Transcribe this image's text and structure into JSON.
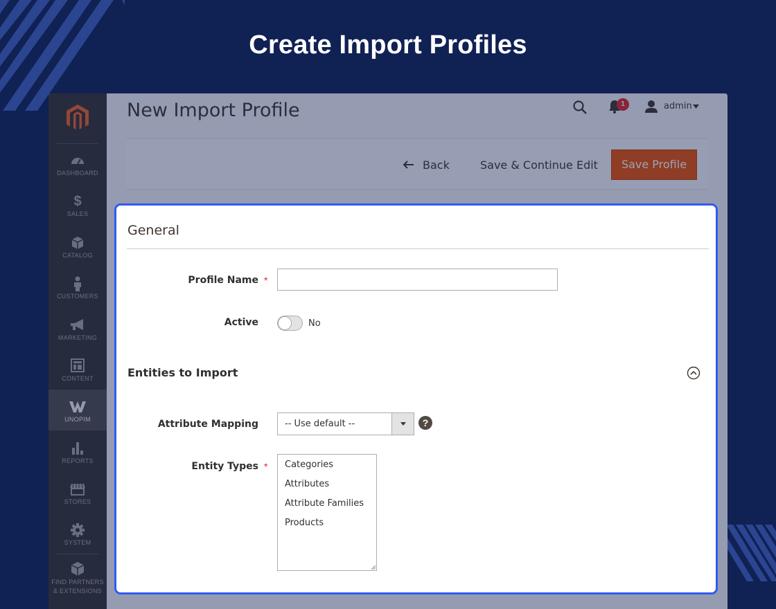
{
  "hero": {
    "title": "Create Import Profiles"
  },
  "sidebar": {
    "items": [
      {
        "label": "DASHBOARD",
        "icon": "speedometer-icon"
      },
      {
        "label": "SALES",
        "icon": "dollar-icon"
      },
      {
        "label": "CATALOG",
        "icon": "box-icon"
      },
      {
        "label": "CUSTOMERS",
        "icon": "person-icon"
      },
      {
        "label": "MARKETING",
        "icon": "megaphone-icon"
      },
      {
        "label": "CONTENT",
        "icon": "layout-icon"
      },
      {
        "label": "UNOPIM",
        "icon": "unopim-logo-icon"
      },
      {
        "label": "REPORTS",
        "icon": "bar-chart-icon"
      },
      {
        "label": "STORES",
        "icon": "storefront-icon"
      },
      {
        "label": "SYSTEM",
        "icon": "gear-icon"
      },
      {
        "label": "FIND PARTNERS",
        "label2": "& EXTENSIONS",
        "icon": "cube-icon"
      }
    ],
    "active": "UNOPIM"
  },
  "header": {
    "title": "New Import Profile",
    "notifications_count": "1",
    "user": "admin"
  },
  "actions": {
    "back": "Back",
    "save_continue": "Save & Continue Edit",
    "save_profile": "Save Profile"
  },
  "form": {
    "section_title": "General",
    "profile_name": {
      "label": "Profile Name",
      "value": "",
      "required": true
    },
    "active": {
      "label": "Active",
      "state": "No"
    },
    "entities_section": "Entities to Import",
    "attribute_mapping": {
      "label": "Attribute Mapping",
      "value": "-- Use default --"
    },
    "entity_types": {
      "label": "Entity Types",
      "required": true,
      "options": [
        "Categories",
        "Attributes",
        "Attribute Families",
        "Products"
      ]
    }
  },
  "colors": {
    "background": "#102154",
    "highlight_border": "#2e5bf0",
    "primary_button": "#eb5202",
    "sidebar": "#373330",
    "required": "#e22626"
  }
}
